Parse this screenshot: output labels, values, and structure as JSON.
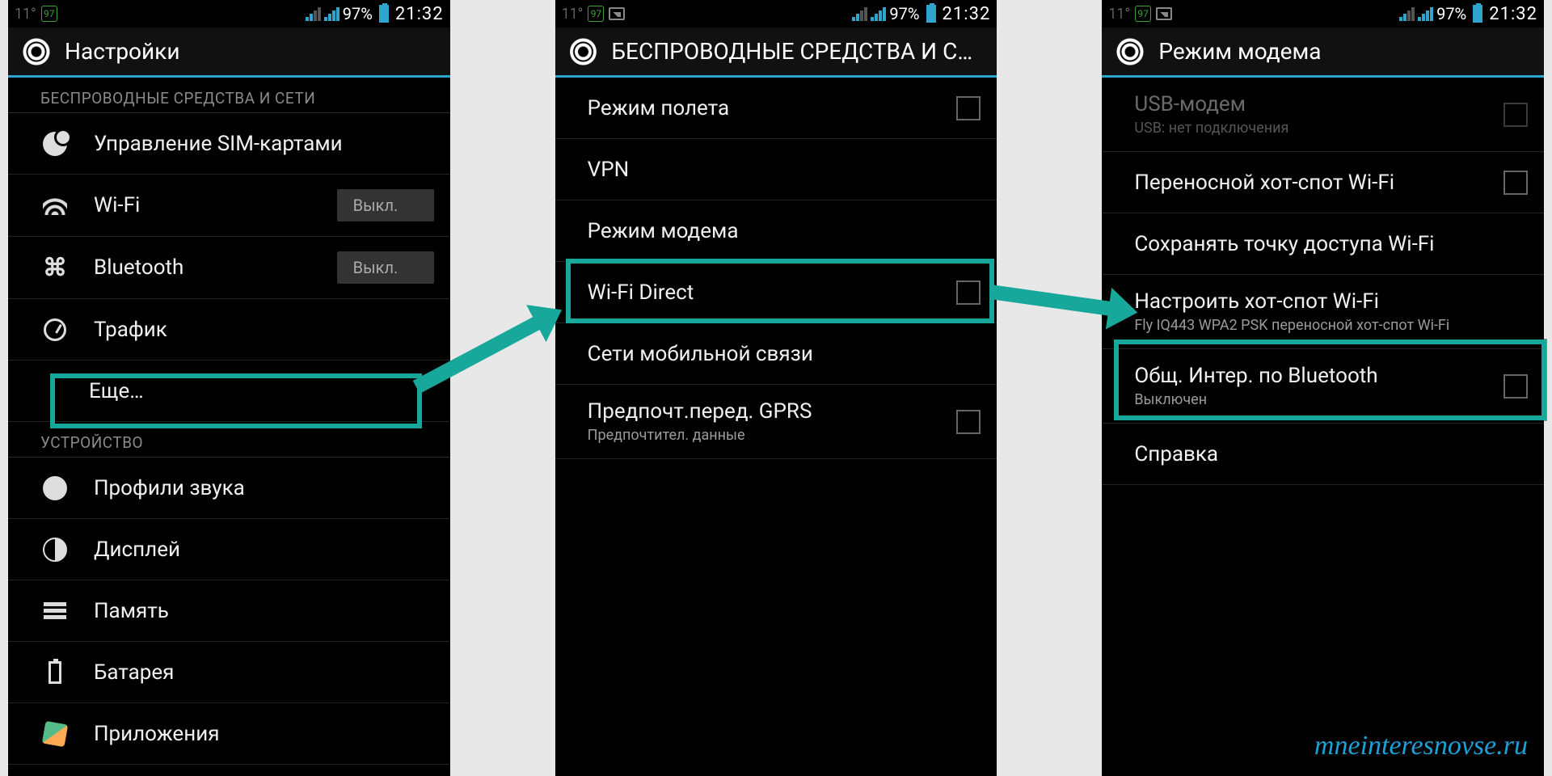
{
  "status": {
    "temp": "11°",
    "badge": "97",
    "battery_pct": "97%",
    "clock": "21:32"
  },
  "watermark": "mneinteresnovse.ru",
  "phone1": {
    "title": "Настройки",
    "cat_wireless": "БЕСПРОВОДНЫЕ СРЕДСТВА И СЕТИ",
    "cat_device": "УСТРОЙСТВО",
    "sim": "Управление SIM-картами",
    "wifi": "Wi-Fi",
    "wifi_state": "Выкл.",
    "bt": "Bluetooth",
    "bt_state": "Выкл.",
    "traffic": "Трафик",
    "more": "Еще…",
    "audio": "Профили звука",
    "display": "Дисплей",
    "memory": "Память",
    "battery": "Батарея",
    "apps": "Приложения"
  },
  "phone2": {
    "title": "БЕСПРОВОДНЫЕ СРЕДСТВА И СЕ…",
    "airplane": "Режим полета",
    "vpn": "VPN",
    "tether": "Режим модема",
    "wifidirect": "Wi-Fi Direct",
    "mobile": "Сети мобильной связи",
    "gprs": "Предпочт.перед. GPRS",
    "gprs_sub": "Предпочтител. данные"
  },
  "phone3": {
    "title": "Режим модема",
    "usb": "USB-модем",
    "usb_sub": "USB: нет подключения",
    "hotspot": "Переносной хот-спот Wi-Fi",
    "keep": "Сохранять точку доступа Wi-Fi",
    "configure": "Настроить хот-спот Wi-Fi",
    "configure_sub": "Fly IQ443 WPA2 PSK переносной хот-спот Wi-Fi",
    "btshare": "Общ. Интер. по Bluetooth",
    "btshare_sub": "Выключен",
    "help": "Справка"
  }
}
